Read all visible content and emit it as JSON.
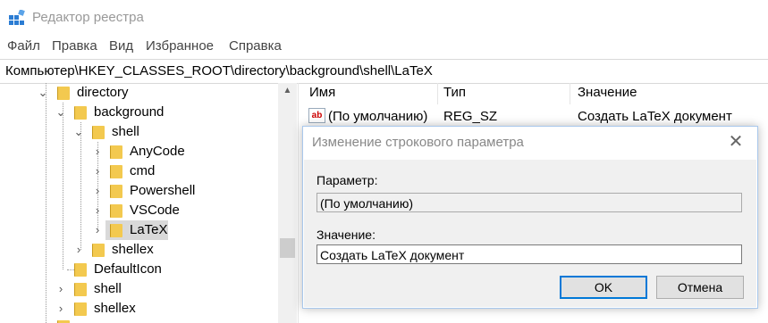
{
  "window": {
    "title": "Редактор реестра",
    "icon": "regedit-icon"
  },
  "menu": [
    "Файл",
    "Правка",
    "Вид",
    "Избранное",
    "Справка"
  ],
  "address": "Компьютер\\HKEY_CLASSES_ROOT\\directory\\background\\shell\\LaTeX",
  "tree": {
    "items": [
      {
        "label": "directory",
        "expand": "v"
      },
      {
        "label": "background",
        "expand": "v"
      },
      {
        "label": "shell",
        "expand": "v"
      },
      {
        "label": "AnyCode",
        "expand": ">"
      },
      {
        "label": "cmd",
        "expand": ">"
      },
      {
        "label": "Powershell",
        "expand": ">"
      },
      {
        "label": "VSCode",
        "expand": ">"
      },
      {
        "label": "LaTeX",
        "expand": ">",
        "selected": true
      },
      {
        "label": "shellex",
        "expand": ">"
      },
      {
        "label": "DefaultIcon",
        "expand": ""
      },
      {
        "label": "shell",
        "expand": ">"
      },
      {
        "label": "shellex",
        "expand": ">"
      }
    ]
  },
  "list": {
    "headers": {
      "name": "Имя",
      "type": "Тип",
      "value": "Значение"
    },
    "rows": [
      {
        "name": "(По умолчанию)",
        "type": "REG_SZ",
        "value": "Создать LaTeX документ"
      }
    ]
  },
  "dialog": {
    "title": "Изменение строкового параметра",
    "param_label": "Параметр:",
    "param_value": "(По умолчанию)",
    "value_label": "Значение:",
    "value_value": "Создать LaTeX документ",
    "ok": "OK",
    "cancel": "Отмена"
  },
  "colors": {
    "accent": "#0078d7",
    "folder": "#f3c94f",
    "selection": "#d9d9d9"
  }
}
